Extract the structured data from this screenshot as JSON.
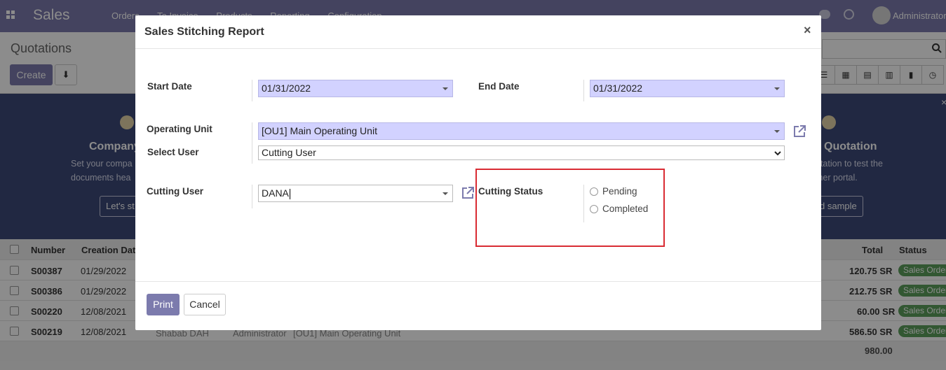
{
  "navbar": {
    "app_name": "Sales",
    "menu": [
      "Orders",
      "To Invoice",
      "Products",
      "Reporting",
      "Configuration"
    ],
    "user": "Administrator"
  },
  "control_panel": {
    "breadcrumb": "Quotations",
    "create_label": "Create"
  },
  "banner": {
    "left_title": "Company",
    "left_text_1": "Set your compa",
    "left_text_2": "documents hea",
    "left_button": "Let's st",
    "right_title": "Quotation",
    "right_text_1": "otation to test the",
    "right_text_2": "mer portal.",
    "right_button": "d sample"
  },
  "list": {
    "headers": {
      "number": "Number",
      "creation_date": "Creation Date",
      "total": "Total",
      "status": "Status"
    },
    "rows": [
      {
        "number": "S00387",
        "date": "01/29/2022",
        "total": "120.75 SR",
        "status": "Sales Order"
      },
      {
        "number": "S00386",
        "date": "01/29/2022",
        "total": "212.75 SR",
        "status": "Sales Order"
      },
      {
        "number": "S00220",
        "date": "12/08/2021",
        "total": "60.00 SR",
        "status": "Sales Order"
      },
      {
        "number": "S00219",
        "date": "12/08/2021",
        "total": "586.50 SR",
        "status": "Sales Order",
        "customer": "Shabab DAH",
        "salesperson": "Administrator",
        "unit": "[OU1] Main Operating Unit"
      }
    ],
    "grand_total": "980.00"
  },
  "modal": {
    "title": "Sales Stitching Report",
    "close": "×",
    "start_date_label": "Start Date",
    "start_date_value": "01/31/2022",
    "end_date_label": "End Date",
    "end_date_value": "01/31/2022",
    "operating_unit_label": "Operating Unit",
    "operating_unit_value": "[OU1] Main Operating Unit",
    "select_user_label": "Select User",
    "select_user_value": "Cutting User",
    "cutting_user_label": "Cutting User",
    "cutting_user_value": "DANA",
    "cutting_status_label": "Cutting Status",
    "status_options": [
      "Pending",
      "Completed"
    ],
    "print_label": "Print",
    "cancel_label": "Cancel"
  },
  "colors": {
    "brand": "#7c7bad",
    "required_field": "#d2d2ff",
    "highlight": "#d92b33",
    "status_badge": "#5c9f5c"
  }
}
